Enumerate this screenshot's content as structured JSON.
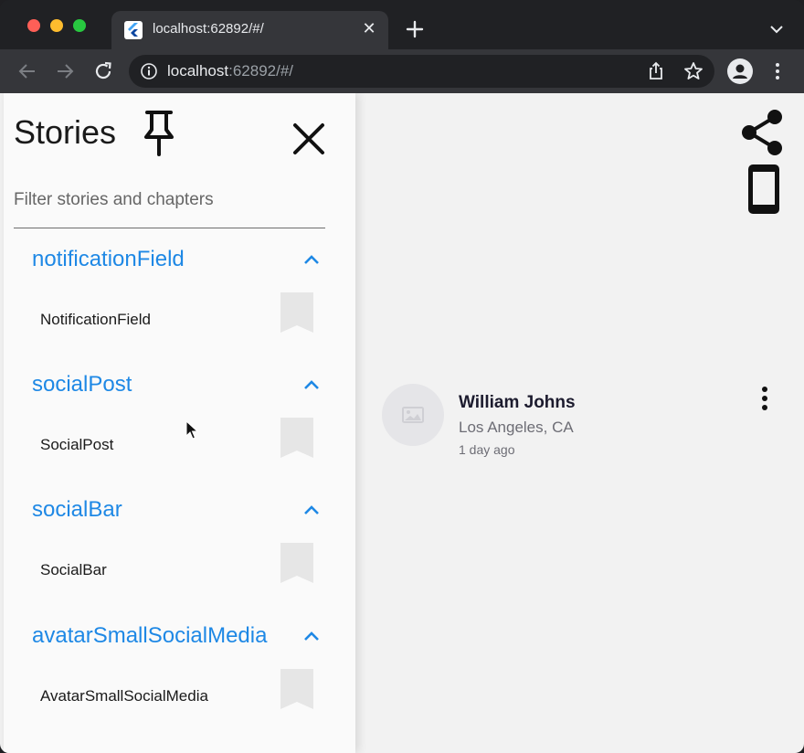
{
  "browser": {
    "tab_title": "localhost:62892/#/",
    "tab_close": "✕",
    "url_host": "localhost",
    "url_path": ":62892/#/"
  },
  "drawer": {
    "title": "Stories",
    "filter_placeholder": "Filter stories and chapters",
    "sections": [
      {
        "header": "notificationField",
        "story": "NotificationField",
        "selected": true
      },
      {
        "header": "socialPost",
        "story": "SocialPost",
        "selected": false
      },
      {
        "header": "socialBar",
        "story": "SocialBar",
        "selected": false
      },
      {
        "header": "avatarSmallSocialMedia",
        "story": "AvatarSmallSocialMedia",
        "selected": false
      }
    ]
  },
  "post": {
    "name": "William Johns",
    "location": "Los Angeles, CA",
    "time": "1 day ago"
  },
  "colors": {
    "accent": "#1e88e5",
    "drawer_bg": "#fafafa",
    "page_bg": "#f2f2f2",
    "avatar_placeholder": "#e5e5e8"
  }
}
